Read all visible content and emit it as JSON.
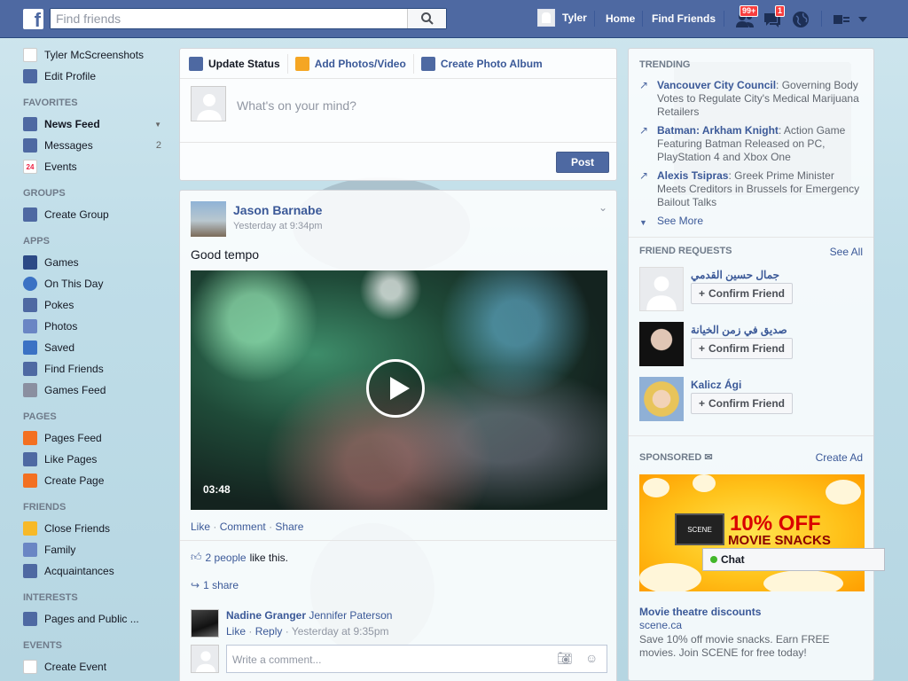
{
  "topbar": {
    "search_placeholder": "Find friends",
    "user_name": "Tyler",
    "home": "Home",
    "find_friends": "Find Friends",
    "friend_requests_badge": "99+",
    "messages_badge": "1"
  },
  "sidebar": {
    "profile_name": "Tyler McScreenshots",
    "edit_profile": "Edit Profile",
    "favorites_header": "FAVORITES",
    "favorites": [
      {
        "label": "News Feed",
        "count": ""
      },
      {
        "label": "Messages",
        "count": "2"
      },
      {
        "label": "Events",
        "count": ""
      }
    ],
    "events_icon_number": "24",
    "groups_header": "GROUPS",
    "groups": [
      {
        "label": "Create Group"
      }
    ],
    "apps_header": "APPS",
    "apps": [
      {
        "label": "Games"
      },
      {
        "label": "On This Day"
      },
      {
        "label": "Pokes"
      },
      {
        "label": "Photos"
      },
      {
        "label": "Saved"
      },
      {
        "label": "Find Friends"
      },
      {
        "label": "Games Feed"
      }
    ],
    "pages_header": "PAGES",
    "pages": [
      {
        "label": "Pages Feed"
      },
      {
        "label": "Like Pages"
      },
      {
        "label": "Create Page"
      }
    ],
    "friends_header": "FRIENDS",
    "friends": [
      {
        "label": "Close Friends"
      },
      {
        "label": "Family"
      },
      {
        "label": "Acquaintances"
      }
    ],
    "interests_header": "INTERESTS",
    "interests": [
      {
        "label": "Pages and Public ..."
      }
    ],
    "events_header": "EVENTS",
    "events": [
      {
        "label": "Create Event"
      }
    ]
  },
  "composer": {
    "tabs": [
      {
        "label": "Update Status"
      },
      {
        "label": "Add Photos/Video"
      },
      {
        "label": "Create Photo Album"
      }
    ],
    "placeholder": "What's on your mind?",
    "post_button": "Post"
  },
  "story": {
    "author": "Jason Barnabe",
    "time": "Yesterday at 9:34pm",
    "text": "Good tempo",
    "video_duration": "03:48",
    "actions": {
      "like": "Like",
      "comment": "Comment",
      "share": "Share"
    },
    "likes_count": "2 people",
    "likes_suffix": "like this.",
    "shares": "1 share",
    "comment": {
      "author": "Nadine Granger",
      "text": "Jennifer Paterson",
      "like": "Like",
      "reply": "Reply",
      "time": "Yesterday at 9:35pm"
    },
    "write_comment_placeholder": "Write a comment..."
  },
  "trending": {
    "header": "TRENDING",
    "items": [
      {
        "title": "Vancouver City Council",
        "desc": ": Governing Body Votes to Regulate City's Medical Marijuana Retailers"
      },
      {
        "title": "Batman: Arkham Knight",
        "desc": ": Action Game Featuring Batman Released on PC, PlayStation 4 and Xbox One"
      },
      {
        "title": "Alexis Tsipras",
        "desc": ": Greek Prime Minister Meets Creditors in Brussels for Emergency Bailout Talks"
      }
    ],
    "see_more": "See More"
  },
  "friend_requests": {
    "header": "FRIEND REQUESTS",
    "see_all": "See All",
    "items": [
      {
        "name": "جمال حسين القدمي",
        "button": "Confirm Friend"
      },
      {
        "name": "صديق في زمن الخيانة",
        "button": "Confirm Friend"
      },
      {
        "name": "Kalicz Ági",
        "button": "Confirm Friend"
      }
    ]
  },
  "sponsored": {
    "header": "SPONSORED",
    "create_ad": "Create Ad",
    "ad_percent": "10% OFF",
    "ad_snacks": "MOVIE SNACKS",
    "ad_logo": "SCENE",
    "ad_title": "Movie theatre discounts",
    "ad_domain": "scene.ca",
    "ad_desc": "Save 10% off movie snacks. Earn FREE movies. Join SCENE for free today!"
  },
  "chat": {
    "label": "Chat"
  },
  "colors": {
    "brand": "#4e69a2",
    "link": "#3b5998",
    "badge": "#fa3e3e"
  }
}
